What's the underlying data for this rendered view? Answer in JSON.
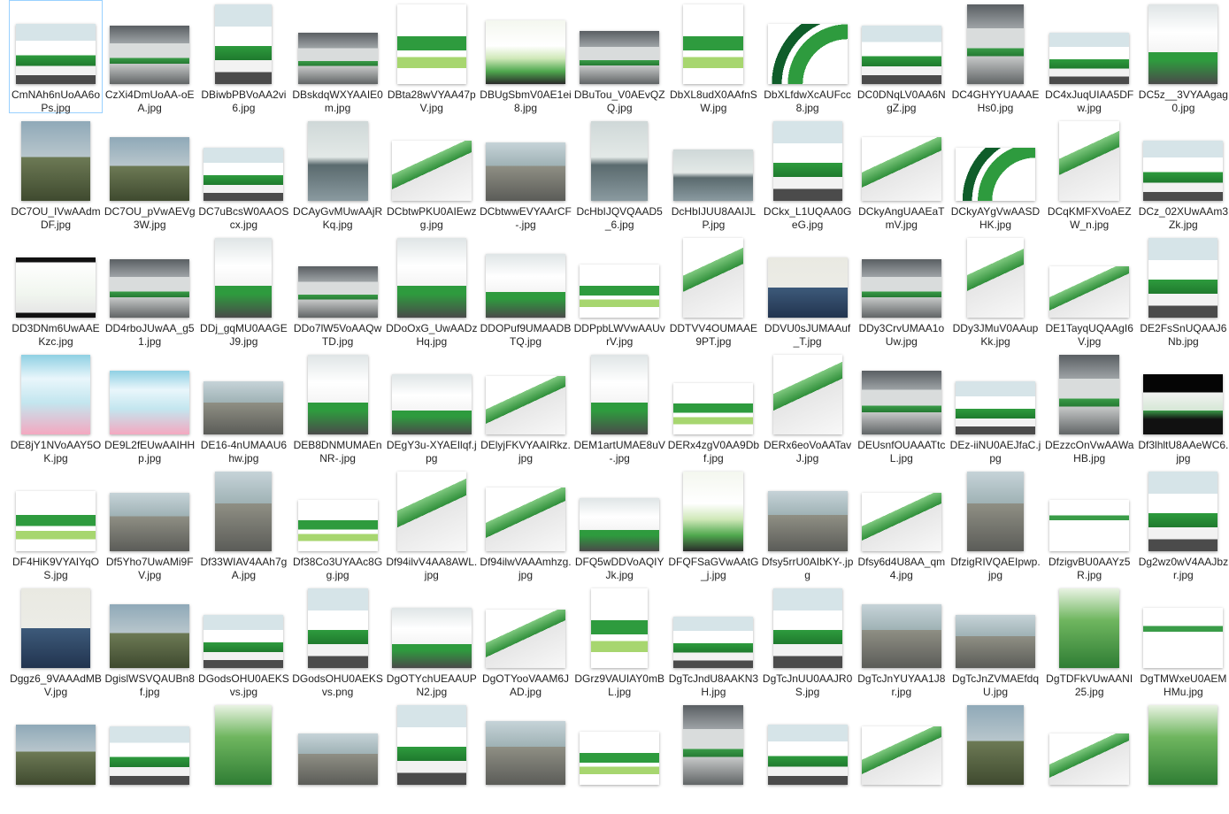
{
  "window": {
    "view": "Large icons"
  },
  "selected_index": 0,
  "files": [
    {
      "name": "CmNAh6nUoAA6oPs.jpg",
      "icon": "bus-thumbnail"
    },
    {
      "name": "CzXi4DmUoAA-oEA.jpg",
      "icon": "train-thumbnail"
    },
    {
      "name": "DBiwbPBVoAA2vi6.jpg",
      "icon": "bus-thumbnail"
    },
    {
      "name": "DBskdqWXYAAIE0m.jpg",
      "icon": "train-thumbnail"
    },
    {
      "name": "DBta28wVYAA47pV.jpg",
      "icon": "table-thumbnail"
    },
    {
      "name": "DBUgSbmV0AE1ei8.jpg",
      "icon": "anime-thumbnail"
    },
    {
      "name": "DBuTou_V0AEvQZQ.jpg",
      "icon": "train-thumbnail"
    },
    {
      "name": "DbXL8udX0AAfnSW.jpg",
      "icon": "stripe-thumbnail"
    },
    {
      "name": "DbXLfdwXcAUFcc8.jpg",
      "icon": "arc-thumbnail"
    },
    {
      "name": "DC0DNqLV0AA6NgZ.jpg",
      "icon": "bus-thumbnail"
    },
    {
      "name": "DC4GHYYUAAAEHs0.jpg",
      "icon": "train-thumbnail"
    },
    {
      "name": "DC4xJuqUIAA5DFw.jpg",
      "icon": "bus-thumbnail"
    },
    {
      "name": "DC5z__3VYAAgag0.jpg",
      "icon": "car-thumbnail"
    },
    {
      "name": "DC7OU_IVwAAdmDF.jpg",
      "icon": "photo-thumbnail"
    },
    {
      "name": "DC7OU_pVwAEVg3W.jpg",
      "icon": "photo-thumbnail"
    },
    {
      "name": "DC7uBcsW0AAOScx.jpg",
      "icon": "bus-thumbnail"
    },
    {
      "name": "DCAyGvMUwAAjRKq.jpg",
      "icon": "plane-thumbnail"
    },
    {
      "name": "DCbtwPKU0AIEwzg.jpg",
      "icon": "box-thumbnail"
    },
    {
      "name": "DCbtwwEVYAArCF-.jpg",
      "icon": "building-thumbnail"
    },
    {
      "name": "DcHbIJQVQAAD5_6.jpg",
      "icon": "sea-thumbnail"
    },
    {
      "name": "DcHbIJUU8AAIJLP.jpg",
      "icon": "sea-thumbnail"
    },
    {
      "name": "DCkx_L1UQAA0GeG.jpg",
      "icon": "bus-thumbnail"
    },
    {
      "name": "DCkyAngUAAEaTmV.jpg",
      "icon": "box-thumbnail"
    },
    {
      "name": "DCkyAYgVwAASDHK.jpg",
      "icon": "arc-thumbnail"
    },
    {
      "name": "DCqKMFXVoAEZW_n.jpg",
      "icon": "box-thumbnail"
    },
    {
      "name": "DCz_02XUwAAm3Zk.jpg",
      "icon": "bus-thumbnail"
    },
    {
      "name": "DD3DNm6UwAAEKzc.jpg",
      "icon": "phone-thumbnail"
    },
    {
      "name": "DD4rboJUwAA_g51.jpg",
      "icon": "train-thumbnail"
    },
    {
      "name": "DDj_gqMU0AAGEJ9.jpg",
      "icon": "car-thumbnail"
    },
    {
      "name": "DDo7lW5VoAAQwTD.jpg",
      "icon": "train-thumbnail"
    },
    {
      "name": "DDoOxG_UwAADzHq.jpg",
      "icon": "truck-thumbnail"
    },
    {
      "name": "DDOPuf9UMAADBTQ.jpg",
      "icon": "truck-thumbnail"
    },
    {
      "name": "DDPpbLWVwAAUvrV.jpg",
      "icon": "door-thumbnail"
    },
    {
      "name": "DDTVV4OUMAAE9PT.jpg",
      "icon": "box-thumbnail"
    },
    {
      "name": "DDVU0sJUMAAuf_T.jpg",
      "icon": "person-thumbnail"
    },
    {
      "name": "DDy3CrvUMAA1oUw.jpg",
      "icon": "train-thumbnail"
    },
    {
      "name": "DDy3JMuV0AAupKk.jpg",
      "icon": "box-thumbnail"
    },
    {
      "name": "DE1TayqUQAAgI6V.jpg",
      "icon": "box-thumbnail"
    },
    {
      "name": "DE2FsSnUQAAJ6Nb.jpg",
      "icon": "bus-thumbnail"
    },
    {
      "name": "DE8jY1NVoAAY5OK.jpg",
      "icon": "card-thumbnail"
    },
    {
      "name": "DE9L2fEUwAAIHHp.jpg",
      "icon": "card-thumbnail"
    },
    {
      "name": "DE16-4nUMAAU6hw.jpg",
      "icon": "mirror-thumbnail"
    },
    {
      "name": "DEB8DNMUMAEnNR-.jpg",
      "icon": "truck-thumbnail"
    },
    {
      "name": "DEgY3u-XYAEIlqf.jpg",
      "icon": "car-thumbnail"
    },
    {
      "name": "DElyjFKVYAAIRkz.jpg",
      "icon": "box-thumbnail"
    },
    {
      "name": "DEM1artUMAE8uV-.jpg",
      "icon": "truck-thumbnail"
    },
    {
      "name": "DERx4zgV0AA9Dbf.jpg",
      "icon": "station-thumbnail"
    },
    {
      "name": "DERx6eoVoAATavJ.jpg",
      "icon": "box-thumbnail"
    },
    {
      "name": "DEUsnfOUAAATtcL.jpg",
      "icon": "train-thumbnail"
    },
    {
      "name": "DEz-iiNU0AEJfaC.jpg",
      "icon": "bus-thumbnail"
    },
    {
      "name": "DEzzcOnVwAAWaHB.jpg",
      "icon": "train-thumbnail"
    },
    {
      "name": "Df3lhltU8AAeWC6.jpg",
      "icon": "shoe-thumbnail"
    },
    {
      "name": "DF4HiK9VYAIYqOS.jpg",
      "icon": "stripe-thumbnail"
    },
    {
      "name": "Df5Yho7UwAMi9FV.jpg",
      "icon": "street-thumbnail"
    },
    {
      "name": "Df33WIAV4AAh7gA.jpg",
      "icon": "street-thumbnail"
    },
    {
      "name": "Df38Co3UYAAc8Gg.jpg",
      "icon": "stripe-thumbnail"
    },
    {
      "name": "Df94ilvV4AA8AWL.jpg",
      "icon": "box-thumbnail"
    },
    {
      "name": "Df94ilwVAAAmhzg.jpg",
      "icon": "box-thumbnail"
    },
    {
      "name": "DFQ5wDDVoAQIYJk.jpg",
      "icon": "truck-thumbnail"
    },
    {
      "name": "DFQFSaGVwAAtG_j.jpg",
      "icon": "anime-thumbnail"
    },
    {
      "name": "Dfsy5rrU0AIbKY-.jpg",
      "icon": "street-thumbnail"
    },
    {
      "name": "Dfsy6d4U8AA_qm4.jpg",
      "icon": "box-thumbnail"
    },
    {
      "name": "DfzigRIVQAEIpwp.jpg",
      "icon": "street-thumbnail"
    },
    {
      "name": "DfzigvBU0AAYz5R.jpg",
      "icon": "sign-thumbnail"
    },
    {
      "name": "Dg2wz0wV4AAJbzr.jpg",
      "icon": "bus-thumbnail"
    },
    {
      "name": "Dggz6_9VAAAdMBV.jpg",
      "icon": "person-thumbnail"
    },
    {
      "name": "DgislWSVQAUBn8f.jpg",
      "icon": "photo-thumbnail"
    },
    {
      "name": "DGodsOHU0AEKSvs.jpg",
      "icon": "bus-thumbnail"
    },
    {
      "name": "DGodsOHU0AEKSvs.png",
      "icon": "bus-thumbnail"
    },
    {
      "name": "DgOTYchUEAAUPN2.jpg",
      "icon": "truck-thumbnail"
    },
    {
      "name": "DgOTYooVAAM6JAD.jpg",
      "icon": "box-thumbnail"
    },
    {
      "name": "DGrz9VAUIAY0mBL.jpg",
      "icon": "stripe-thumbnail"
    },
    {
      "name": "DgTcJndU8AAKN3H.jpg",
      "icon": "bus-thumbnail"
    },
    {
      "name": "DgTcJnUU0AAJR0S.jpg",
      "icon": "bus-thumbnail"
    },
    {
      "name": "DgTcJnYUYAA1J8r.jpg",
      "icon": "mirror-thumbnail"
    },
    {
      "name": "DgTcJnZVMAEfdqU.jpg",
      "icon": "mirror-thumbnail"
    },
    {
      "name": "DgTDFkVUwAANI25.jpg",
      "icon": "green-thumbnail"
    },
    {
      "name": "DgTMWxeU0AEMHMu.jpg",
      "icon": "sign-thumbnail"
    },
    {
      "name": "",
      "icon": "photo-thumbnail"
    },
    {
      "name": "",
      "icon": "bus-thumbnail"
    },
    {
      "name": "",
      "icon": "green-thumbnail"
    },
    {
      "name": "",
      "icon": "street-thumbnail"
    },
    {
      "name": "",
      "icon": "bus-thumbnail"
    },
    {
      "name": "",
      "icon": "street-thumbnail"
    },
    {
      "name": "",
      "icon": "stripe-thumbnail"
    },
    {
      "name": "",
      "icon": "train-thumbnail"
    },
    {
      "name": "",
      "icon": "bus-thumbnail"
    },
    {
      "name": "",
      "icon": "box-thumbnail"
    },
    {
      "name": "",
      "icon": "photo-thumbnail"
    },
    {
      "name": "",
      "icon": "box-thumbnail"
    },
    {
      "name": "",
      "icon": "green-thumbnail"
    }
  ]
}
